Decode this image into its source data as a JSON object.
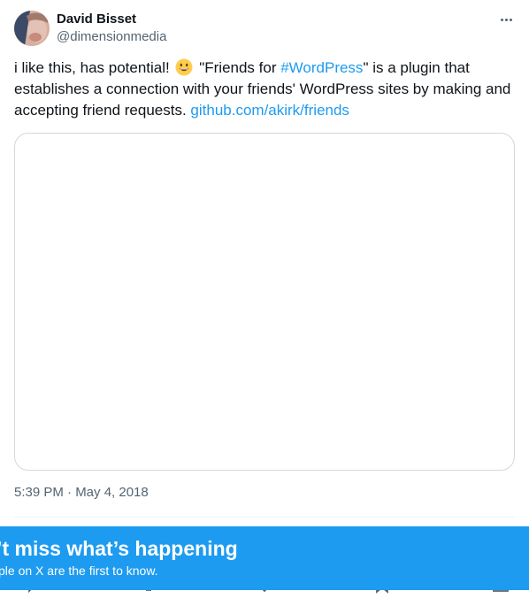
{
  "author": {
    "name": "David Bisset",
    "handle": "@dimensionmedia"
  },
  "tweet": {
    "text_part1": "i like this, has potential! ",
    "text_part2": " \"Friends for ",
    "hashtag": "#WordPress",
    "text_part3": "\" is a plugin that establishes a connection with your friends' WordPress sites by making and accepting friend requests. ",
    "link": "github.com/akirk/friends",
    "timestamp": "5:39 PM · May 4, 2018"
  },
  "banner": {
    "title": "n’t miss what’s happening",
    "subtitle": "ple on X are the first to know."
  },
  "colors": {
    "accent": "#1d9bf0",
    "secondary_text": "#536471",
    "primary_text": "#0f1419",
    "border": "#cfd9de"
  },
  "icons": [
    "more-icon",
    "smiley-emoji",
    "reply-icon",
    "retweet-icon",
    "like-icon",
    "bookmark-icon",
    "share-icon"
  ]
}
